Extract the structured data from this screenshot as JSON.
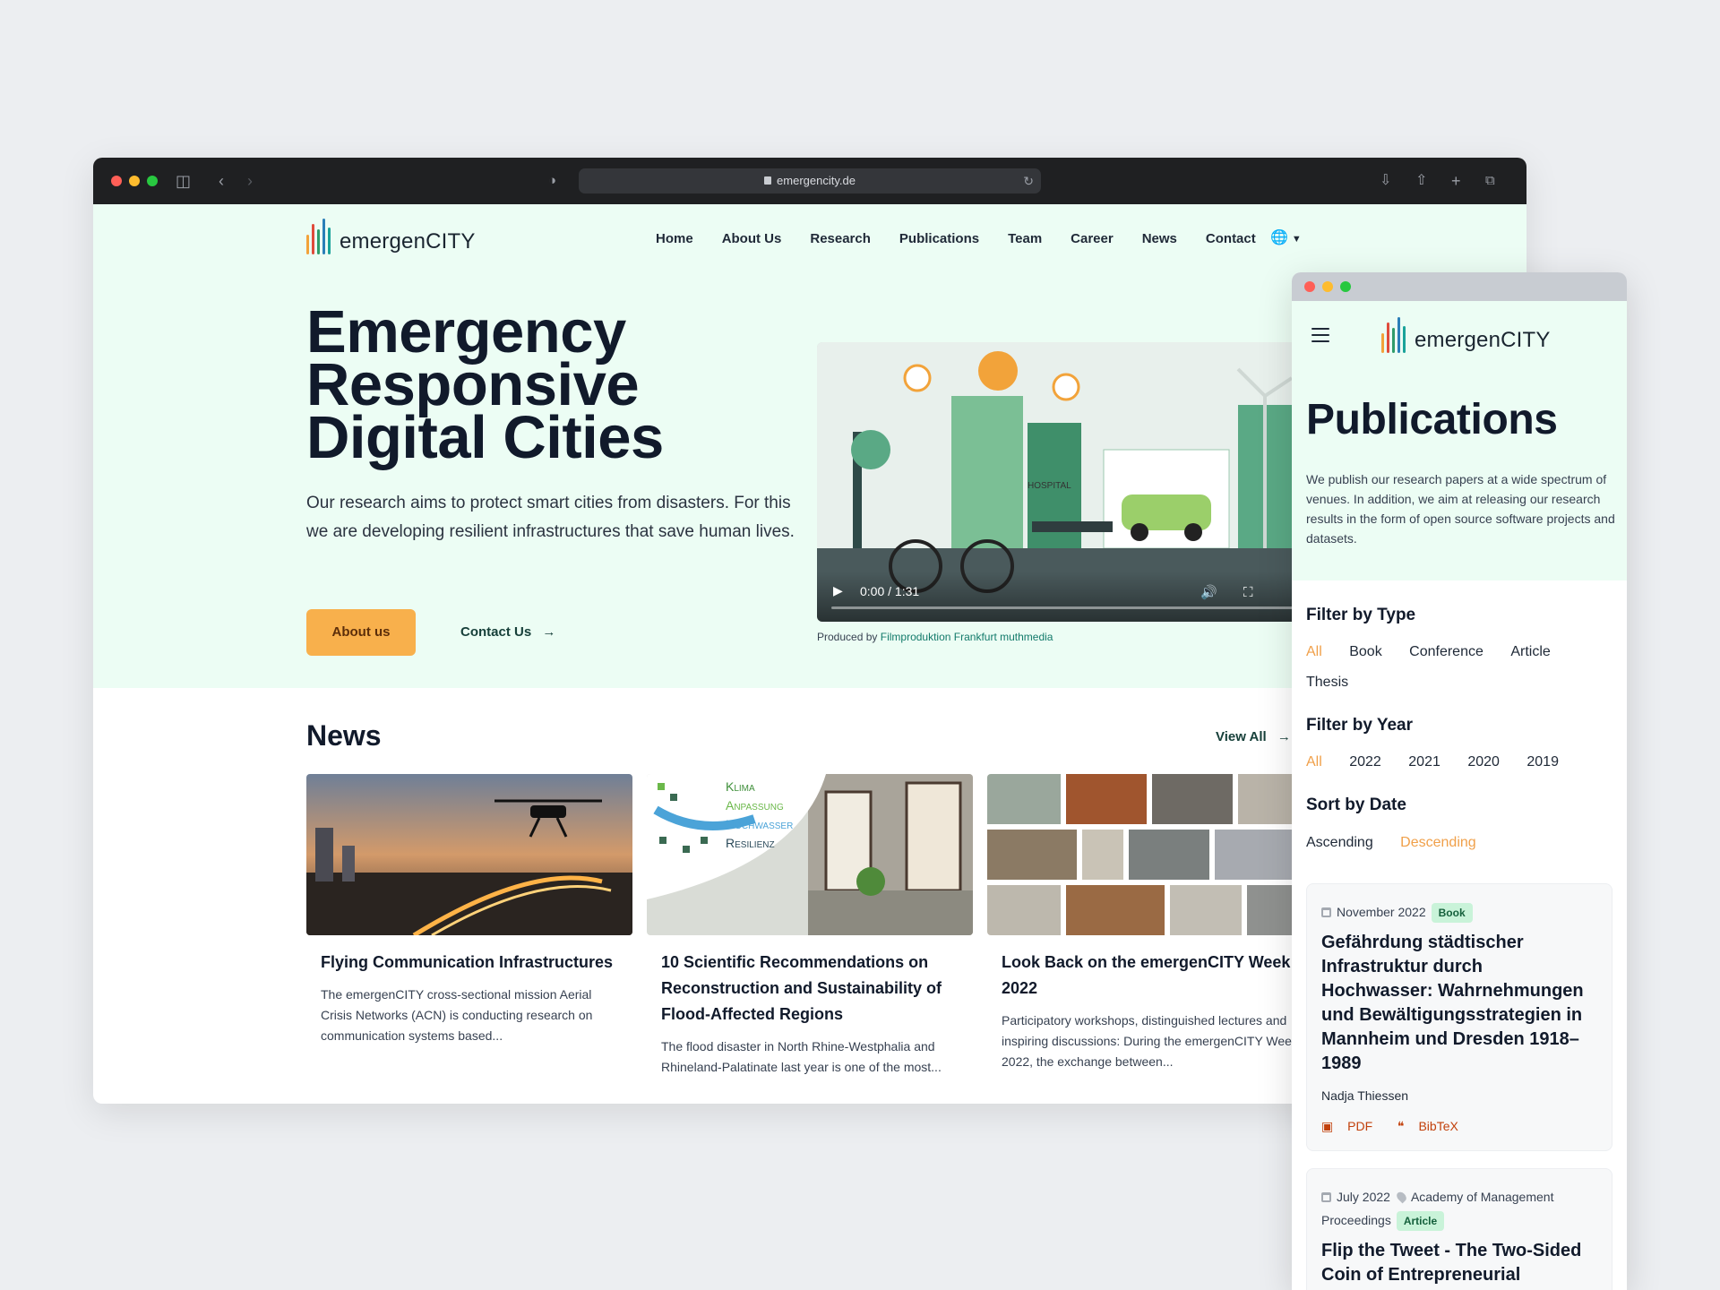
{
  "browser": {
    "url": "emergencity.de"
  },
  "site": {
    "logo_text": "emergenCITY",
    "nav": [
      "Home",
      "About Us",
      "Research",
      "Publications",
      "Team",
      "Career",
      "News",
      "Contact"
    ],
    "hero": {
      "title": "Emergency Responsive Digital Cities",
      "text": "Our research aims to protect smart cities from disasters. For this we are developing resilient infrastructures that save human lives.",
      "about_button": "About us",
      "contact_link": "Contact Us"
    },
    "video": {
      "time": "0:00 / 1:31",
      "hospital_sign": "HOSPITAL",
      "credit_prefix": "Produced by",
      "credit_link": "Filmproduktion Frankfurt muthmedia"
    },
    "news": {
      "heading": "News",
      "view_all": "View All",
      "cards": [
        {
          "title": "Flying Communication Infrastructures",
          "text": "The emergenCITY cross-sectional mission Aerial Crisis Networks (ACN) is conducting research on communication systems based..."
        },
        {
          "title": "10 Scientific Recommendations on Reconstruction and Sustainability of Flood-Affected Regions",
          "text": "The flood disaster in North Rhine-Westphalia and Rhineland-Palatinate last year is one of the most...",
          "image_text": [
            "Klima",
            "Anpassung",
            "Hochwasser",
            "Resilienz"
          ]
        },
        {
          "title": "Look Back on the emergenCITY Week 2022",
          "text": "Participatory workshops, distinguished lectures and inspiring discussions: During the emergenCITY Week 2022, the exchange between..."
        }
      ]
    }
  },
  "mobile": {
    "logo_text": "emergenCITY",
    "page_title": "Publications",
    "intro": "We publish our research papers at a wide spectrum of venues. In addition, we aim at releasing our research results in the form of open source software projects and datasets.",
    "filter_type": {
      "label": "Filter by Type",
      "options": [
        "All",
        "Book",
        "Conference",
        "Article",
        "Thesis"
      ],
      "selected": "All"
    },
    "filter_year": {
      "label": "Filter by Year",
      "options": [
        "All",
        "2022",
        "2021",
        "2020",
        "2019"
      ],
      "selected": "All"
    },
    "sort": {
      "label": "Sort by Date",
      "options": [
        "Ascending",
        "Descending"
      ],
      "selected": "Descending"
    },
    "publications": [
      {
        "date": "November 2022",
        "type": "Book",
        "title": "Gefährdung städtischer Infrastruktur durch Hochwasser: Wahrnehmungen und Bewältigungsstrategien in Mannheim und Dresden 1918–1989",
        "author": "Nadja Thiessen",
        "pdf": "PDF",
        "bibtex": "BibTeX"
      },
      {
        "date": "July 2022",
        "venue": "Academy of Management Proceedings",
        "type": "Article",
        "title": "Flip the Tweet - The Two-Sided Coin of Entrepreneurial"
      }
    ]
  },
  "colors": {
    "accent_orange": "#f8b04c",
    "mint_background": "#ecfdf4",
    "badge_green": "#c9f3d9",
    "link_red": "#c2410c"
  }
}
